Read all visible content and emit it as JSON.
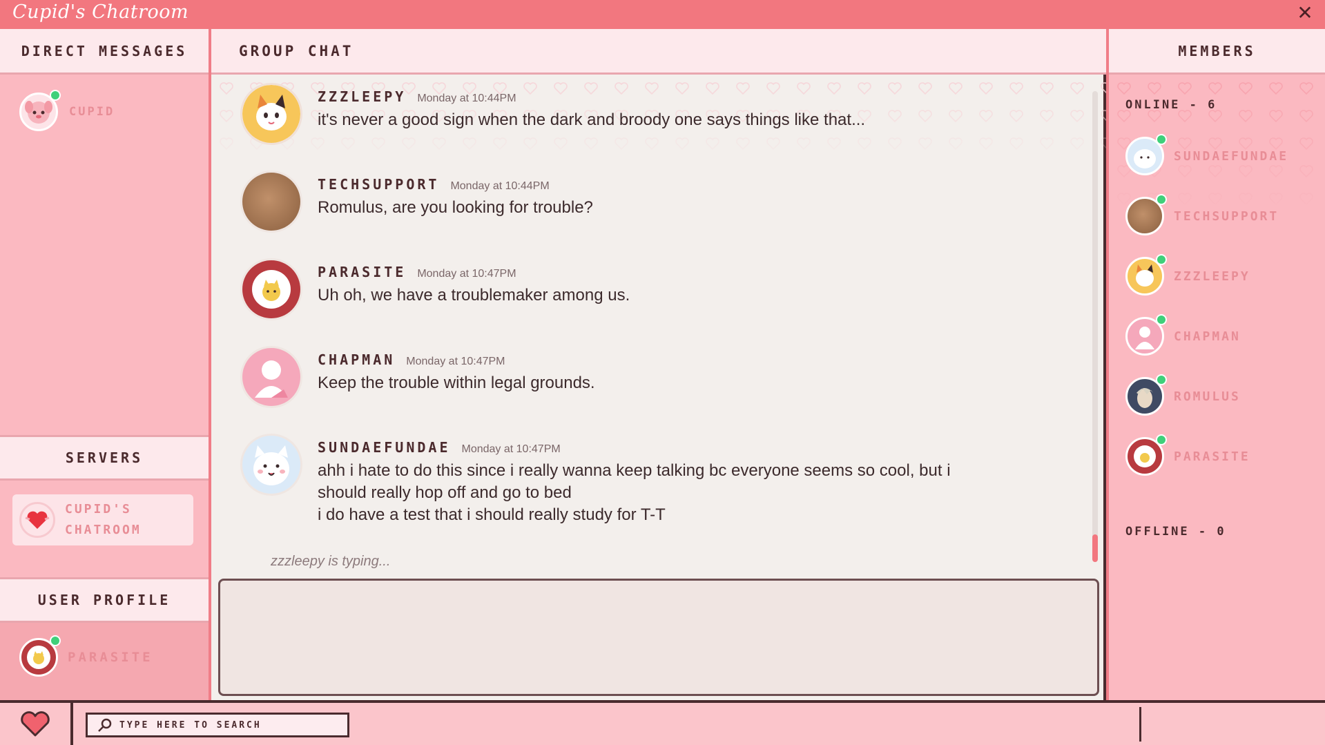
{
  "app": {
    "title": "Cupid's Chatroom",
    "close_label": "✕"
  },
  "direct_messages": {
    "header": "Direct Messages",
    "items": [
      {
        "label": "Cupid",
        "online": true
      }
    ]
  },
  "servers": {
    "header": "Servers",
    "items": [
      {
        "label_line1": "Cupid's",
        "label_line2": "Chatroom"
      }
    ]
  },
  "user_profile": {
    "header": "User Profile",
    "name": "Parasite",
    "online": true
  },
  "group_chat": {
    "header": "Group Chat",
    "messages": [
      {
        "name": "zzzleepy",
        "time": "Monday at 10:44PM",
        "text": "it's never a good sign when the dark and broody one says things like that..."
      },
      {
        "name": "TechSupport",
        "time": "Monday at 10:44PM",
        "text": "Romulus, are you looking for trouble?"
      },
      {
        "name": "Parasite",
        "time": "Monday at 10:47PM",
        "text": "Uh oh, we have a troublemaker among us."
      },
      {
        "name": "Chapman",
        "time": "Monday at 10:47PM",
        "text": "Keep the trouble within legal grounds."
      },
      {
        "name": "SundaeFundae",
        "time": "Monday at 10:47PM",
        "text": "ahh i hate to do this since i really wanna keep talking bc everyone seems so cool, but i\nshould really hop off and go to bed\ni do have a test that i should really study for T-T"
      }
    ],
    "typing_indicator": "zzzleepy is typing...",
    "composer_value": ""
  },
  "members": {
    "header": "Members",
    "online_label": "Online - 6",
    "offline_label": "Offline - 0",
    "online": [
      {
        "name": "SundaeFundae"
      },
      {
        "name": "TechSupport"
      },
      {
        "name": "zzzleepy"
      },
      {
        "name": "Chapman"
      },
      {
        "name": "Romulus"
      },
      {
        "name": "Parasite"
      }
    ]
  },
  "bottom": {
    "search_placeholder": "Type here to search"
  },
  "colors": {
    "accent": "#f2777f",
    "online_dot": "#3fd07a",
    "dark_border": "#4a2b2e",
    "label_pink": "#e88d96"
  }
}
